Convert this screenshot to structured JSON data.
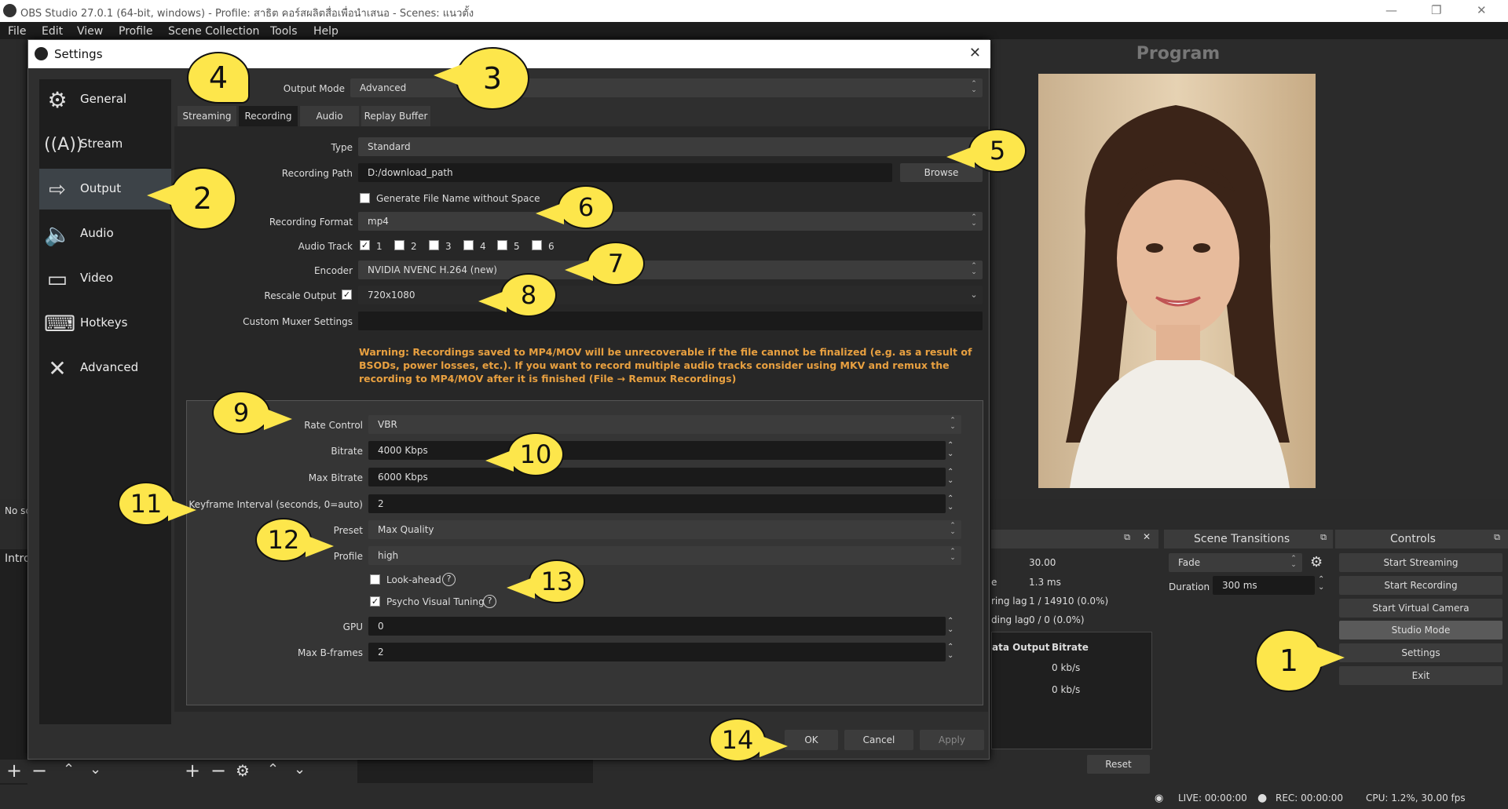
{
  "window": {
    "title": "OBS Studio 27.0.1 (64-bit, windows) - Profile: สาธิต คอร์สผลิตสื่อเพื่อนำเสนอ - Scenes: แนวตั้ง"
  },
  "menu": [
    "File",
    "Edit",
    "View",
    "Profile",
    "Scene Collection",
    "Tools",
    "Help"
  ],
  "program": {
    "title": "Program"
  },
  "left_fragments": {
    "no_source": "No sc",
    "intro": "Intro"
  },
  "stats": {
    "fps": "30.00",
    "frame_time": "1.3 ms",
    "rendering_lag_label": "ring lag",
    "rendering_lag": "1 / 14910 (0.0%)",
    "encoding_lag_label": "ding lag",
    "encoding_lag": "0 / 0 (0.0%)",
    "col1": "ata Output",
    "col2": "Bitrate",
    "bitrate1": "0 kb/s",
    "bitrate2": "0 kb/s",
    "reset": "Reset",
    "frame_time_prefix": "e"
  },
  "transitions": {
    "title": "Scene Transitions",
    "value": "Fade",
    "duration_label": "Duration",
    "duration": "300 ms"
  },
  "controls": {
    "title": "Controls",
    "buttons": [
      "Start Streaming",
      "Start Recording",
      "Start Virtual Camera",
      "Studio Mode",
      "Settings",
      "Exit"
    ]
  },
  "status": {
    "live": "LIVE: 00:00:00",
    "rec": "REC: 00:00:00",
    "cpu": "CPU: 1.2%, 30.00 fps"
  },
  "dialog": {
    "title": "Settings",
    "sidebar": [
      "General",
      "Stream",
      "Output",
      "Audio",
      "Video",
      "Hotkeys",
      "Advanced"
    ],
    "output_mode_label": "Output Mode",
    "output_mode": "Advanced",
    "tabs": [
      "Streaming",
      "Recording",
      "Audio",
      "Replay Buffer"
    ],
    "type_label": "Type",
    "type": "Standard",
    "path_label": "Recording Path",
    "path": "D:/download_path",
    "browse": "Browse",
    "gen_name": "Generate File Name without Space",
    "format_label": "Recording Format",
    "format": "mp4",
    "track_label": "Audio Track",
    "tracks": [
      "1",
      "2",
      "3",
      "4",
      "5",
      "6"
    ],
    "encoder_label": "Encoder",
    "encoder": "NVIDIA NVENC H.264 (new)",
    "rescale_label": "Rescale Output",
    "rescale": "720x1080",
    "muxer_label": "Custom Muxer Settings",
    "warning": "Warning: Recordings saved to MP4/MOV will be unrecoverable if the file cannot be finalized (e.g. as a result of BSODs, power losses, etc.). If you want to record multiple audio tracks consider using MKV and remux the recording to MP4/MOV after it is finished (File → Remux Recordings)",
    "rate_label": "Rate Control",
    "rate": "VBR",
    "bitrate_label": "Bitrate",
    "bitrate": "4000 Kbps",
    "maxbitrate_label": "Max Bitrate",
    "maxbitrate": "6000 Kbps",
    "keyframe_label": "Keyframe Interval (seconds, 0=auto)",
    "keyframe": "2",
    "preset_label": "Preset",
    "preset": "Max Quality",
    "profile_label": "Profile",
    "profile": "high",
    "lookahead": "Look-ahead",
    "psycho": "Psycho Visual Tuning",
    "gpu_label": "GPU",
    "gpu": "0",
    "bframes_label": "Max B-frames",
    "bframes": "2",
    "ok": "OK",
    "cancel": "Cancel",
    "apply": "Apply"
  },
  "callouts": [
    "1",
    "2",
    "3",
    "4",
    "5",
    "6",
    "7",
    "8",
    "9",
    "10",
    "11",
    "12",
    "13",
    "14"
  ]
}
